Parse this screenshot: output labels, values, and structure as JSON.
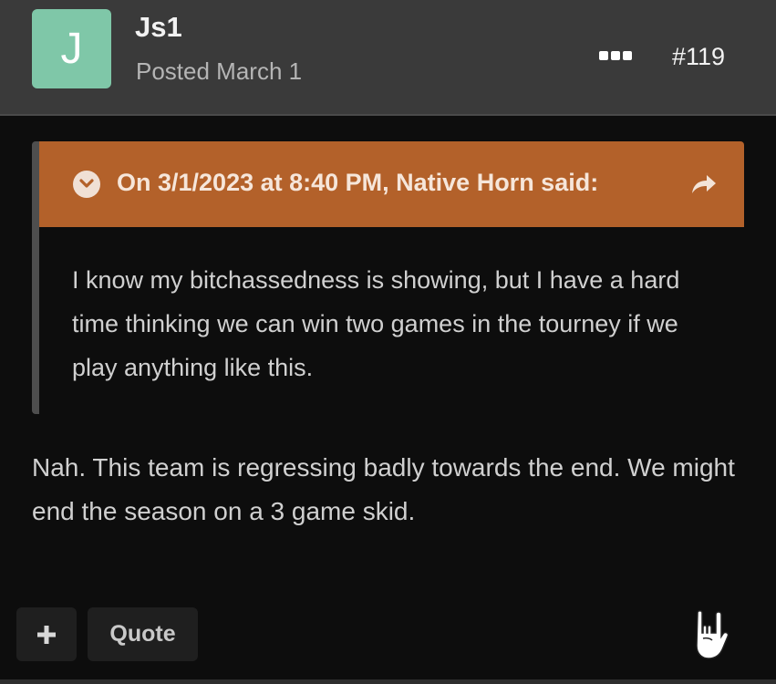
{
  "post": {
    "avatar_letter": "J",
    "author": "Js1",
    "posted": "Posted March 1",
    "number": "#119"
  },
  "quote": {
    "citation": "On 3/1/2023 at 8:40 PM, Native Horn said:",
    "body": "I know my bitchassedness is showing, but I have a hard time thinking we can win two games in the tourney if we play anything like this."
  },
  "body": "Nah. This team is regressing badly towards the end. We might end the season on a 3 game skid.",
  "actions": {
    "quote_label": "Quote"
  },
  "colors": {
    "header_bg": "#3a3a3a",
    "avatar_bg": "#7fc7a8",
    "quote_header_bg": "#b3612a",
    "page_bg": "#0d0d0d"
  },
  "icons": [
    "more-icon",
    "chevron-down-icon",
    "share-icon",
    "plus-icon",
    "rock-hand-icon"
  ]
}
